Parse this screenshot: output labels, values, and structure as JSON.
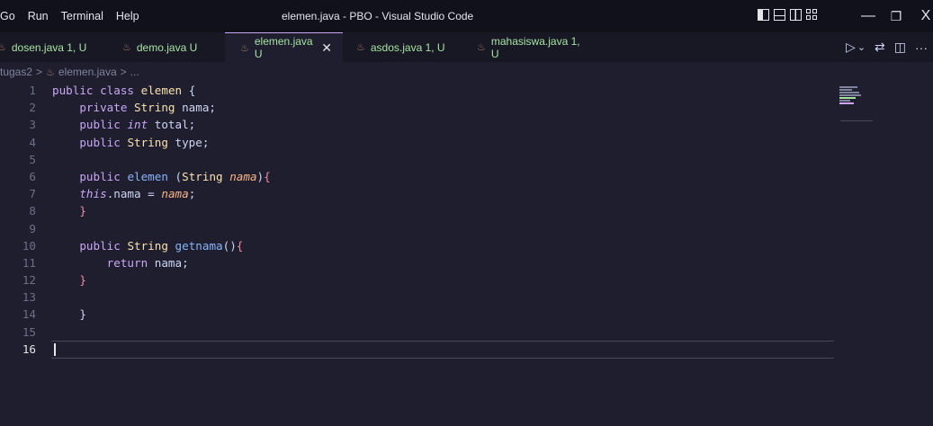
{
  "menu": [
    "Go",
    "Run",
    "Terminal",
    "Help"
  ],
  "window_title": "elemen.java - PBO - Visual Studio Code",
  "window_controls": {
    "minimize": "—",
    "restore": "❐",
    "close": "X"
  },
  "tabs": [
    {
      "label": "dosen.java 1, U",
      "active": false
    },
    {
      "label": "demo.java U",
      "active": false
    },
    {
      "label": "elemen.java U",
      "active": true
    },
    {
      "label": "asdos.java 1, U",
      "active": false
    },
    {
      "label": "mahasiswa.java 1, U",
      "active": false
    }
  ],
  "tab_actions": {
    "run": "▷",
    "run_dropdown": "⌄",
    "compare": "⇄",
    "split": "◫",
    "more": "···"
  },
  "breadcrumb": [
    "tugas2",
    ">",
    "elemen.java",
    ">",
    "..."
  ],
  "code_lines": [
    "1",
    "2",
    "3",
    "4",
    "5",
    "6",
    "7",
    "8",
    "9",
    "10",
    "11",
    "12",
    "13",
    "14",
    "15",
    "16"
  ],
  "current_line": 16,
  "colors": {
    "accent": "#cba6f7",
    "tab_text": "#a6e3a1",
    "keyword": "#cba6f7",
    "type": "#f9e2af",
    "function": "#89b4fa",
    "parameter": "#fab387",
    "brace": "#f38ba8"
  }
}
